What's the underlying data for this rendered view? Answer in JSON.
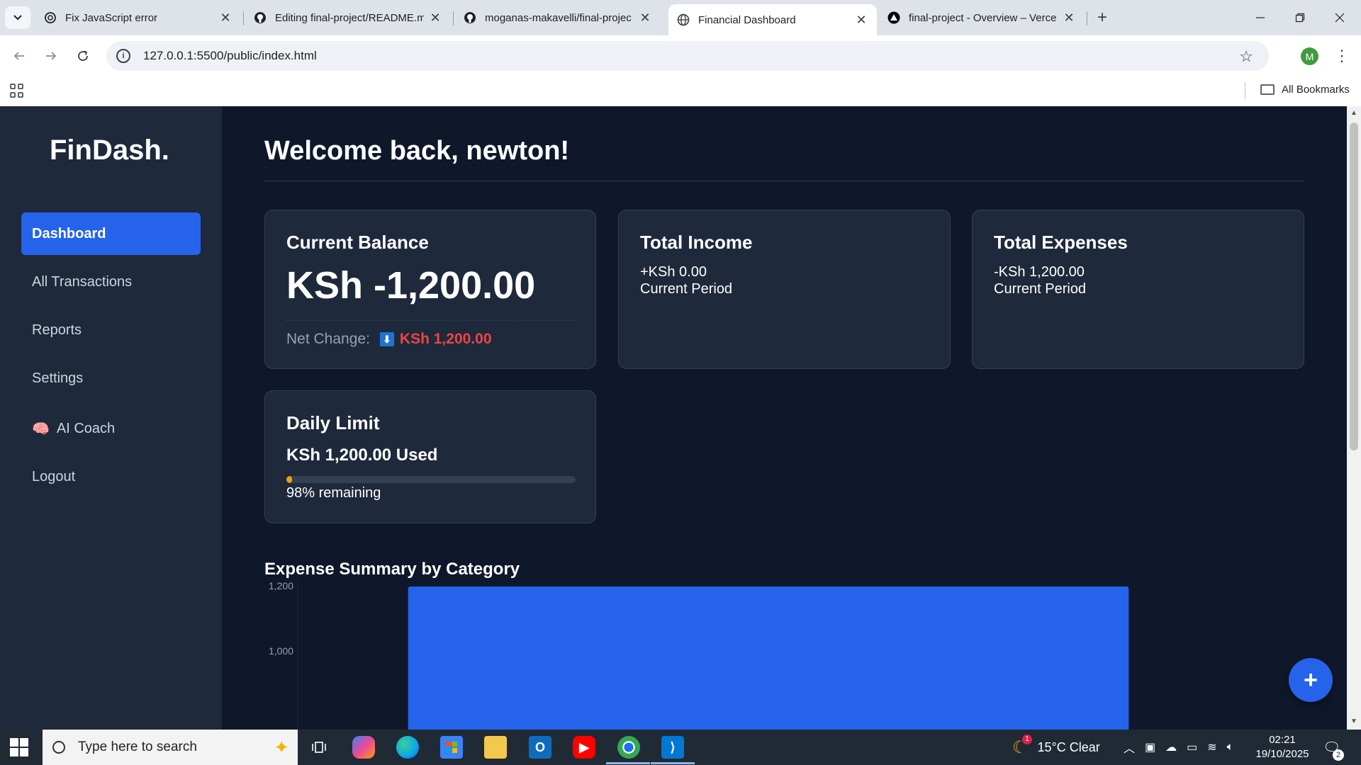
{
  "browser": {
    "tabs": [
      {
        "title": "Fix JavaScript error",
        "icon": "chatgpt-icon"
      },
      {
        "title": "Editing final-project/README.m",
        "icon": "github-icon"
      },
      {
        "title": "moganas-makavelli/final-projec",
        "icon": "github-icon"
      },
      {
        "title": "Financial Dashboard",
        "icon": "globe-icon"
      },
      {
        "title": "final-project - Overview – Verce",
        "icon": "vercel-icon"
      }
    ],
    "url": "127.0.0.1:5500/public/index.html",
    "profile_initial": "M",
    "all_bookmarks_label": "All Bookmarks"
  },
  "sidebar": {
    "logo": "FinDash.",
    "items": [
      {
        "label": "Dashboard",
        "active": true
      },
      {
        "label": "All Transactions"
      },
      {
        "label": "Reports"
      },
      {
        "label": "Settings"
      },
      {
        "label": "AI Coach",
        "icon": "🧠"
      },
      {
        "label": "Logout"
      }
    ]
  },
  "main": {
    "welcome": "Welcome back, newton!",
    "balance": {
      "title": "Current Balance",
      "value": "KSh -1,200.00",
      "net_label": "Net Change:",
      "net_icon": "⬇",
      "net_value": "KSh 1,200.00"
    },
    "income": {
      "title": "Total Income",
      "value": "+KSh 0.00",
      "period": "Current Period"
    },
    "expenses": {
      "title": "Total Expenses",
      "value": "-KSh 1,200.00",
      "period": "Current Period"
    },
    "daily_limit": {
      "title": "Daily Limit",
      "used": "KSh 1,200.00 Used",
      "remaining_text": "98% remaining",
      "used_fraction": 0.02
    },
    "chart_title": "Expense Summary by Category",
    "fab_label": "+"
  },
  "chart_data": {
    "type": "bar",
    "title": "Expense Summary by Category",
    "categories": [
      ""
    ],
    "values": [
      1200
    ],
    "ylim": [
      700,
      1200
    ],
    "yticks": [
      "1,200",
      "1,000"
    ],
    "bar_color": "#2563eb"
  },
  "taskbar": {
    "search_placeholder": "Type here to search",
    "weather": "15°C  Clear",
    "time": "02:21",
    "date": "19/10/2025",
    "notification_count": "2",
    "weather_badge": "1"
  },
  "colors": {
    "accent": "#2563eb",
    "negative": "#ef4444",
    "warning": "#f59e0b",
    "sidebar_bg": "#1e293b",
    "page_bg": "#0f172a"
  }
}
